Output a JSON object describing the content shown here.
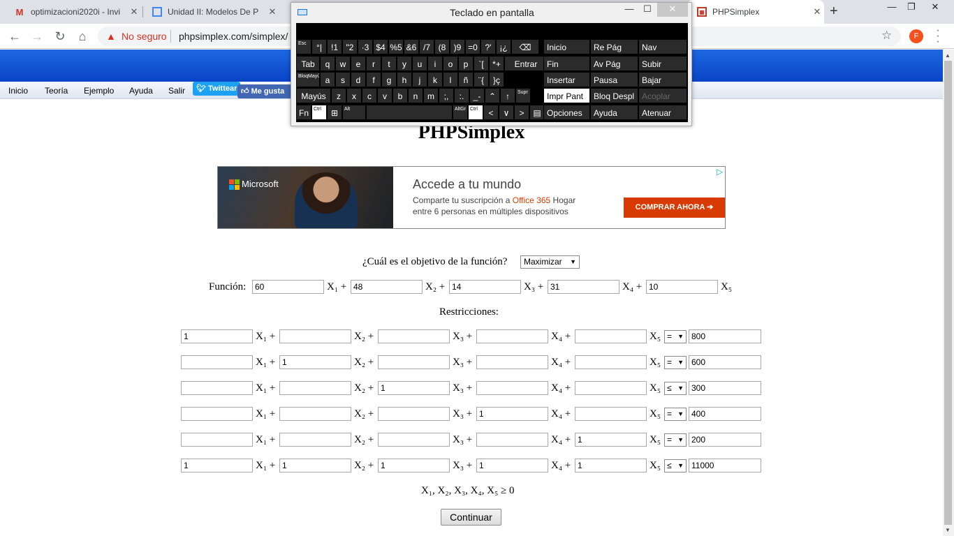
{
  "browser": {
    "tabs": [
      {
        "title": "optimizacioni2020i - Invi",
        "icon": "gmail-icon"
      },
      {
        "title": "Unidad II: Modelos De P",
        "icon": "docs-icon"
      },
      {
        "title": "PHPSimplex",
        "icon": "phpsimplex-icon"
      }
    ],
    "security": "No seguro",
    "url": "phpsimplex.com/simplex/",
    "profile_initial": "F"
  },
  "site": {
    "menu": [
      "Inicio",
      "Teoría",
      "Ejemplo",
      "Ayuda",
      "Salir"
    ],
    "twitter": "Twittear",
    "facebook": "Me gusta",
    "title": "PHPSimplex"
  },
  "ad": {
    "brand": "Microsoft",
    "headline": "Accede a tu mundo",
    "line1_pre": "Comparte tu suscripción a ",
    "line1_hl": "Office 365",
    "line1_post": " Hogar",
    "line2": "entre 6 personas en múltiples dispositivos",
    "cta": "COMPRAR AHORA ➔",
    "colors": [
      "#f25022",
      "#7fba00",
      "#00a4ef",
      "#ffb900"
    ]
  },
  "problem": {
    "objective_label": "¿Cuál es el objetivo de la función?",
    "objective": "Maximizar",
    "function_label": "Función:",
    "coefficients": [
      "60",
      "48",
      "14",
      "31",
      "10"
    ],
    "restrictions_label": "Restricciones:",
    "constraints": [
      {
        "coef": [
          "1",
          "",
          "",
          "",
          ""
        ],
        "op": "=",
        "rhs": "800"
      },
      {
        "coef": [
          "",
          "1",
          "",
          "",
          ""
        ],
        "op": "=",
        "rhs": "600"
      },
      {
        "coef": [
          "",
          "",
          "1",
          "",
          ""
        ],
        "op": "≤",
        "rhs": "300"
      },
      {
        "coef": [
          "",
          "",
          "",
          "1",
          ""
        ],
        "op": "=",
        "rhs": "400"
      },
      {
        "coef": [
          "",
          "",
          "",
          "",
          "1"
        ],
        "op": "=",
        "rhs": "200"
      },
      {
        "coef": [
          "1",
          "1",
          "1",
          "1",
          "1"
        ],
        "op": "≤",
        "rhs": "11000"
      }
    ],
    "nonnegativity": "X₁, X₂, X₃, X₄, X₅ ≥ 0",
    "continue": "Continuar"
  },
  "osk": {
    "title": "Teclado en pantalla",
    "rows": [
      [
        "Esc",
        "°|",
        "!1",
        "\"2",
        "·3",
        "$4",
        "%5",
        "&6",
        "/7",
        "(8",
        ")9",
        "=0",
        "?'",
        "¡¿",
        "⌫"
      ],
      [
        "Tab",
        "q",
        "w",
        "e",
        "r",
        "t",
        "y",
        "u",
        "i",
        "o",
        "p",
        "`[",
        "*+",
        "Entrar"
      ],
      [
        "BloqMayú",
        "a",
        "s",
        "d",
        "f",
        "g",
        "h",
        "j",
        "k",
        "l",
        "ñ",
        "¨{",
        "}ç"
      ],
      [
        "Mayús",
        "z",
        "x",
        "c",
        "v",
        "b",
        "n",
        "m",
        ";,",
        ":.",
        "_-",
        "⌃",
        "↑",
        "Supr"
      ],
      [
        "Fn",
        "Ctrl",
        "⊞",
        "Alt",
        "",
        "AltGr",
        "Ctrl",
        "<",
        "∨",
        ">",
        "▤"
      ]
    ],
    "nav": [
      [
        "Inicio",
        "Re Pág",
        "Nav"
      ],
      [
        "Fin",
        "Av Pág",
        "Subir"
      ],
      [
        "Insertar",
        "Pausa",
        "Bajar"
      ],
      [
        "Impr Pant",
        "Bloq Despl",
        "Acoplar"
      ],
      [
        "Opciones",
        "Ayuda",
        "Atenuar"
      ]
    ]
  }
}
